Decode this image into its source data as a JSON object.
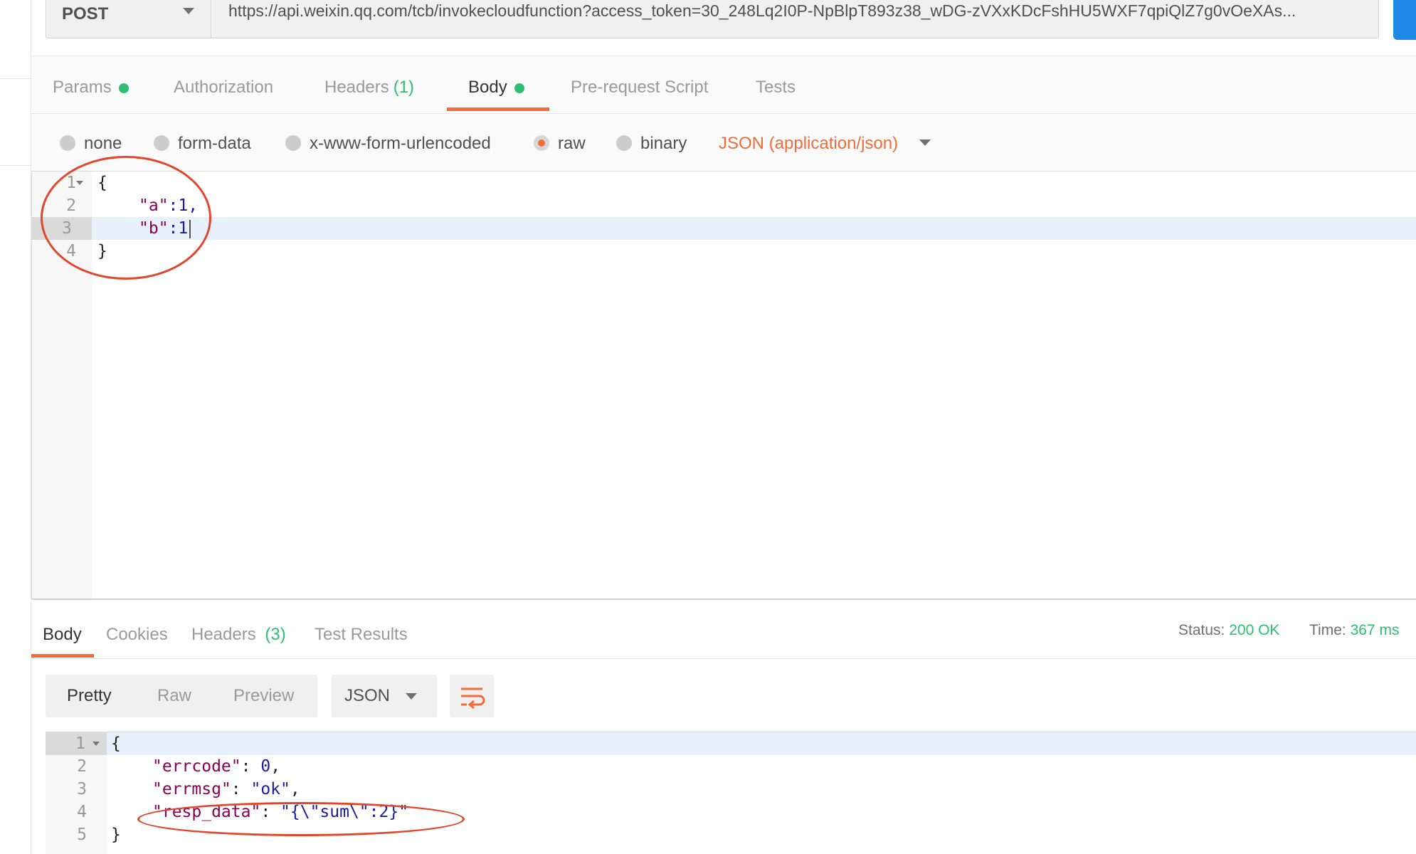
{
  "request": {
    "method": "POST",
    "url": "https://api.weixin.qq.com/tcb/invokecloudfunction?access_token=30_248Lq2I0P-NpBlpT893z38_wDG-zVXxKDcFshHU5WXF7qpiQlZ7g0vOeXAs..."
  },
  "request_tabs": [
    {
      "label": "Params",
      "indicator": "green-dot"
    },
    {
      "label": "Authorization"
    },
    {
      "label": "Headers",
      "count": "(1)"
    },
    {
      "label": "Body",
      "indicator": "green-dot",
      "active": true
    },
    {
      "label": "Pre-request Script"
    },
    {
      "label": "Tests"
    }
  ],
  "body_types": {
    "options": [
      "none",
      "form-data",
      "x-www-form-urlencoded",
      "raw",
      "binary"
    ],
    "selected": "raw",
    "format": "JSON (application/json)"
  },
  "request_body": {
    "line_numbers": [
      "1",
      "2",
      "3",
      "4"
    ],
    "lines": {
      "l1": "{",
      "l2_key": "\"a\"",
      "l2_rest": ":1,",
      "l3_key": "\"b\"",
      "l3_rest": ":1",
      "l4": "}"
    }
  },
  "response_tabs": [
    {
      "label": "Body",
      "active": true
    },
    {
      "label": "Cookies"
    },
    {
      "label": "Headers",
      "count": "(3)"
    },
    {
      "label": "Test Results"
    }
  ],
  "response_status": {
    "status_label": "Status:",
    "status_value": "200 OK",
    "time_label": "Time:",
    "time_value": "367 ms"
  },
  "response_view": {
    "modes": [
      "Pretty",
      "Raw",
      "Preview"
    ],
    "active_mode": "Pretty",
    "format": "JSON",
    "wrap_icon": "wrap-lines-icon"
  },
  "response_body": {
    "line_numbers": [
      "1",
      "2",
      "3",
      "4",
      "5"
    ],
    "l1": "{",
    "l2_key": "\"errcode\"",
    "l2_sep": ": ",
    "l2_val": "0",
    "l2_end": ",",
    "l3_key": "\"errmsg\"",
    "l3_sep": ": ",
    "l3_val": "\"ok\"",
    "l3_end": ",",
    "l4_key": "\"resp_data\"",
    "l4_sep": ": ",
    "l4_val": "\"{\\\"sum\\\":2}\"",
    "l5": "}"
  },
  "colors": {
    "accent": "#f26b3a",
    "success": "#2fbf71",
    "send_button": "#1e88e5",
    "annotation": "#e0472b"
  }
}
